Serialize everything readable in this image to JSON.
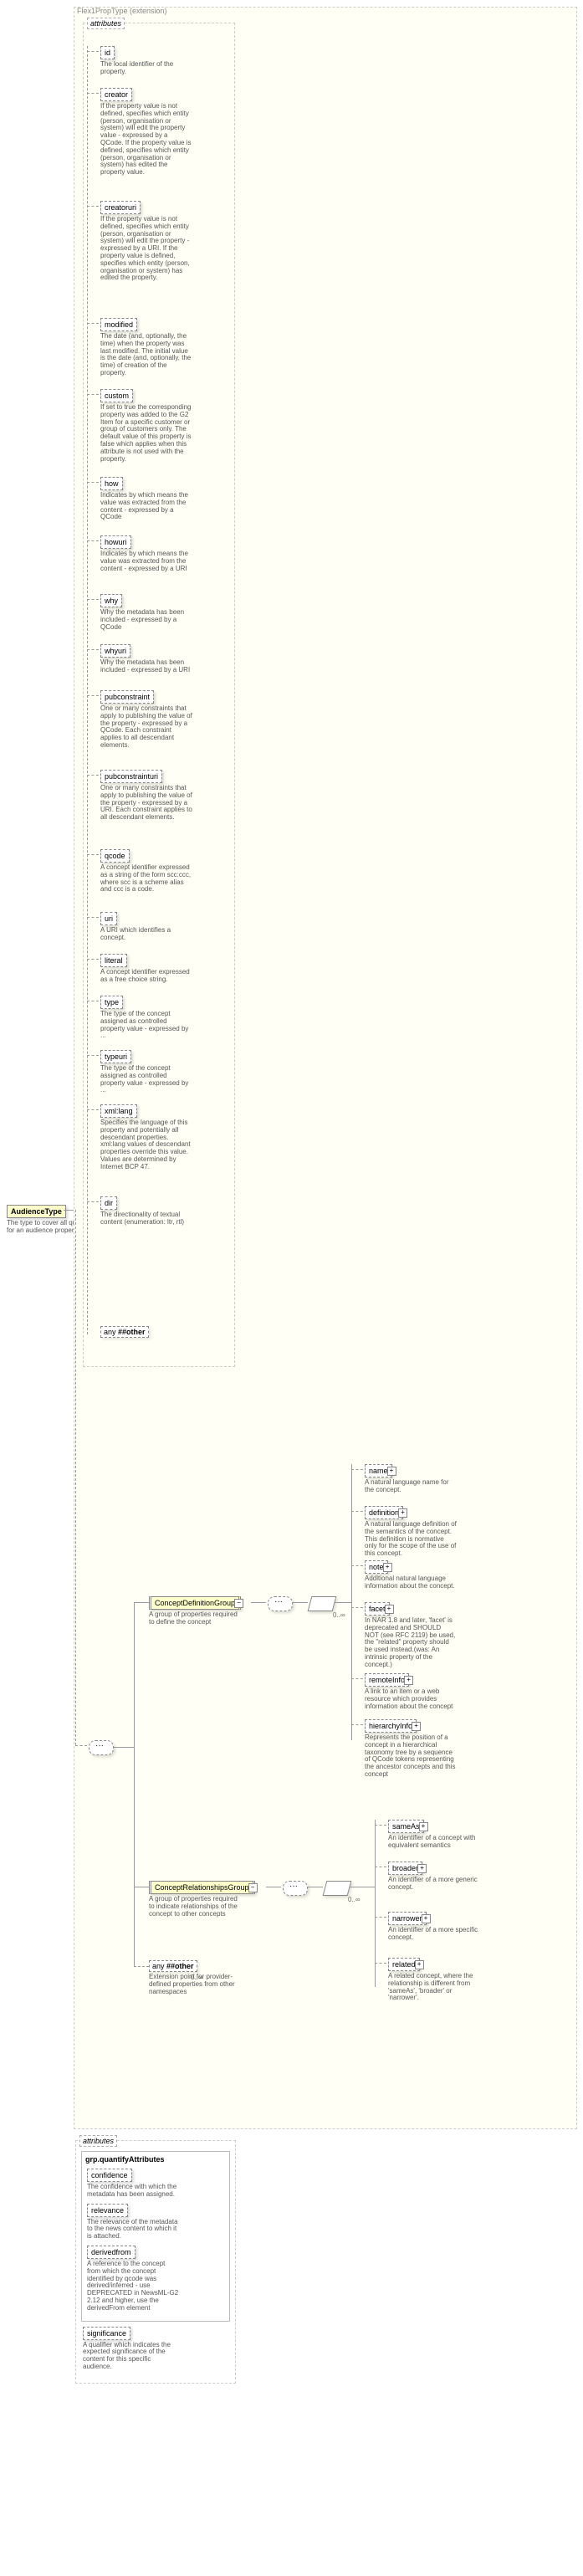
{
  "root": {
    "name": "AudienceType",
    "desc": "The type to cover all qualifiers for an audience property"
  },
  "extension": {
    "label": "Flex1PropType (extension)",
    "attrs_label": "attributes"
  },
  "attrs": [
    {
      "name": "id",
      "desc": "The local identifier of the property."
    },
    {
      "name": "creator",
      "desc": "If the property value is not defined, specifies which entity (person, organisation or system) will edit the property value - expressed by a QCode. If the property value is defined, specifies which entity (person, organisation or system) has edited the property value."
    },
    {
      "name": "creatoruri",
      "desc": "If the property value is not defined, specifies which entity (person, organisation or system) will edit the property - expressed by a URI. If the property value is defined, specifies which entity (person, organisation or system) has edited the property."
    },
    {
      "name": "modified",
      "desc": "The date (and, optionally, the time) when the property was last modified. The initial value is the date (and, optionally, the time) of creation of the property."
    },
    {
      "name": "custom",
      "desc": "If set to true the corresponding property was added to the G2 Item for a specific customer or group of customers only. The default value of this property is false which applies when this attribute is not used with the property."
    },
    {
      "name": "how",
      "desc": "Indicates by which means the value was extracted from the content - expressed by a QCode"
    },
    {
      "name": "howuri",
      "desc": "Indicates by which means the value was extracted from the content - expressed by a URI"
    },
    {
      "name": "why",
      "desc": "Why the metadata has been included - expressed by a QCode"
    },
    {
      "name": "whyuri",
      "desc": "Why the metadata has been included - expressed by a URI"
    },
    {
      "name": "pubconstraint",
      "desc": "One or many constraints that apply to publishing the value of the property - expressed by a QCode. Each constraint applies to all descendant elements."
    },
    {
      "name": "pubconstrainturi",
      "desc": "One or many constraints that apply to publishing the value of the property - expressed by a URI. Each constraint applies to all descendant elements."
    },
    {
      "name": "qcode",
      "desc": "A concept identifier expressed as a string of the form scc:ccc, where scc is a scheme alias and ccc is a code."
    },
    {
      "name": "uri",
      "desc": "A URI which identifies a concept."
    },
    {
      "name": "literal",
      "desc": "A concept identifier expressed as a free choice string."
    },
    {
      "name": "type",
      "desc": "The type of the concept assigned as controlled property value - expressed by ..."
    },
    {
      "name": "typeuri",
      "desc": "The type of the concept assigned as controlled property value - expressed by ..."
    },
    {
      "name": "xml:lang",
      "desc": "Specifies the language of this property and potentially all descendant properties. xml:lang values of descendant properties override this value. Values are determined by Internet BCP 47."
    },
    {
      "name": "dir",
      "desc": "The directionality of textual content (enumeration: ltr, rtl)"
    }
  ],
  "any_attr": {
    "label": "any",
    "src": "##other"
  },
  "cdg": {
    "name": "ConceptDefinitionGroup",
    "desc": "A group of properties required to define the concept"
  },
  "crg": {
    "name": "ConceptRelationshipsGroup",
    "desc": "A group of properties required to indicate relationships of the concept to other concepts"
  },
  "any_elem": {
    "label": "any",
    "src": "##other",
    "desc": "Extension point for provider-defined properties from other namespaces",
    "multi": "0..∞"
  },
  "cdg_children": [
    {
      "name": "name",
      "desc": "A natural language name for the concept."
    },
    {
      "name": "definition",
      "desc": "A natural language definition of the semantics of the concept. This definition is normative only for the scope of the use of this concept."
    },
    {
      "name": "note",
      "desc": "Additional natural language information about the concept."
    },
    {
      "name": "facet",
      "desc": "In NAR 1.8 and later, 'facet' is deprecated and SHOULD NOT (see RFC 2119) be used, the \"related\" property should be used instead.(was: An intrinsic property of the concept.)"
    },
    {
      "name": "remoteInfo",
      "desc": "A link to an item or a web resource which provides information about the concept"
    },
    {
      "name": "hierarchyInfo",
      "desc": "Represents the position of a concept in a hierarchical taxonomy tree by a sequence of QCode tokens representing the ancestor concepts and this concept"
    }
  ],
  "cdg_multi": "0..∞",
  "crg_children": [
    {
      "name": "sameAs",
      "desc": "An identifier of a concept with equivalent semantics"
    },
    {
      "name": "broader",
      "desc": "An identifier of a more generic concept."
    },
    {
      "name": "narrower",
      "desc": "An identifier of a more specific concept."
    },
    {
      "name": "related",
      "desc": "A related concept, where the relationship is different from 'sameAs', 'broader' or 'narrower'."
    }
  ],
  "crg_multi": "0..∞",
  "quant": {
    "label": "attributes",
    "group_name": "grp.quantifyAttributes",
    "attrs": [
      {
        "name": "confidence",
        "desc": "The confidence with which the metadata has been assigned."
      },
      {
        "name": "relevance",
        "desc": "The relevance of the metadata to the news content to which it is attached."
      },
      {
        "name": "derivedfrom",
        "desc": "A reference to the concept from which the concept identified by qcode was derived/inferred - use DEPRECATED in NewsML-G2 2.12 and higher, use the derivedFrom element"
      }
    ],
    "significance": {
      "name": "significance",
      "desc": "A qualifier which indicates the expected significance of the content for this specific audience."
    }
  }
}
